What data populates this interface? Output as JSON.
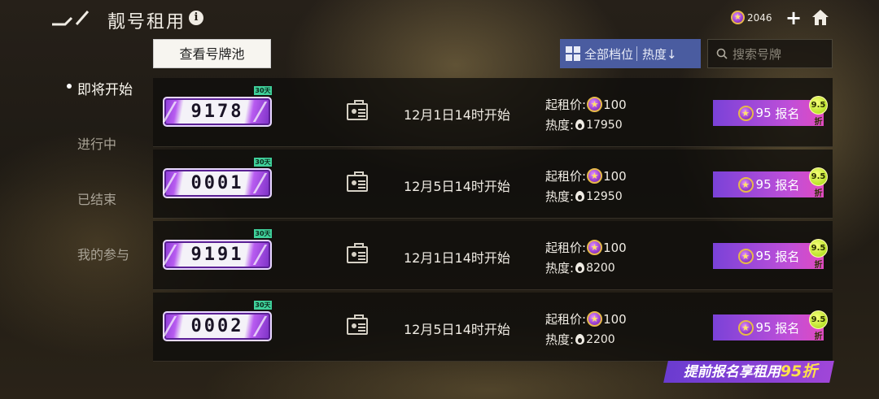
{
  "header": {
    "title": "靓号租用",
    "info_icon": "info-icon",
    "coins": "2046"
  },
  "toolbar": {
    "pool_label": "查看号牌池",
    "filter_label": "全部档位",
    "sort_label": "热度↓",
    "search_placeholder": "搜索号牌"
  },
  "nav": [
    {
      "label": "即将开始",
      "active": true
    },
    {
      "label": "进行中",
      "active": false
    },
    {
      "label": "已结束",
      "active": false
    },
    {
      "label": "我的参与",
      "active": false
    }
  ],
  "labels": {
    "price": "起租价:",
    "heat": "热度:"
  },
  "rows": [
    {
      "plate": "9178",
      "duration": "30天",
      "start": "12月1日14时开始",
      "price": "100",
      "heat": "17950",
      "signup_cost": "95",
      "signup_label": "报名",
      "discount": "9.5折"
    },
    {
      "plate": "0001",
      "duration": "30天",
      "start": "12月5日14时开始",
      "price": "100",
      "heat": "12950",
      "signup_cost": "95",
      "signup_label": "报名",
      "discount": "9.5折"
    },
    {
      "plate": "9191",
      "duration": "30天",
      "start": "12月1日14时开始",
      "price": "100",
      "heat": "8200",
      "signup_cost": "95",
      "signup_label": "报名",
      "discount": "9.5折"
    },
    {
      "plate": "0002",
      "duration": "30天",
      "start": "12月5日14时开始",
      "price": "100",
      "heat": "2200",
      "signup_cost": "95",
      "signup_label": "报名",
      "discount": "9.5折"
    }
  ],
  "promo": {
    "text": "提前报名享租用",
    "discount": "95折"
  },
  "colors": {
    "accent_purple": "#a046d8",
    "filter_blue": "#4a5ca0",
    "coin_gold": "#e6b94a"
  }
}
